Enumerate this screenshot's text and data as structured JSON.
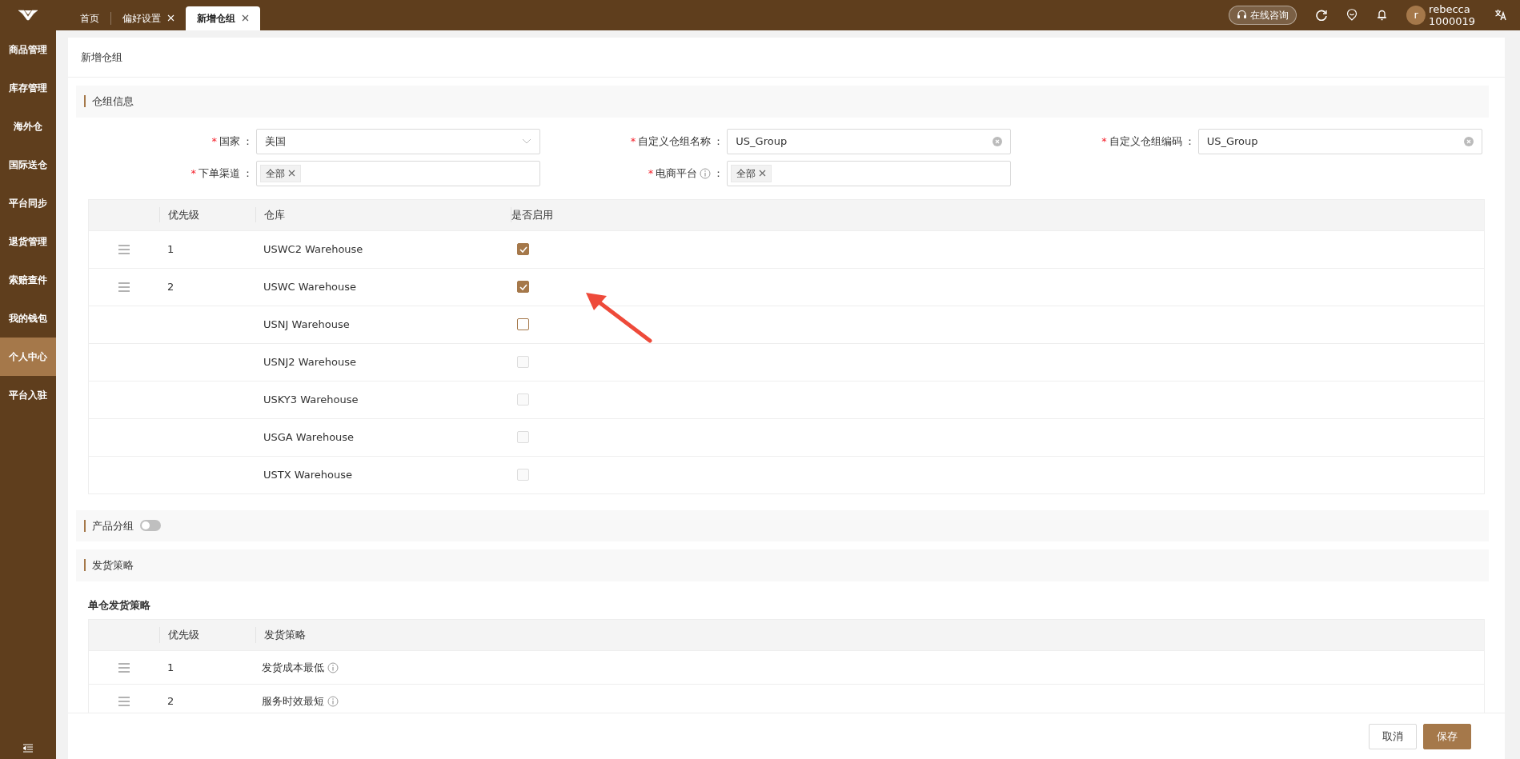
{
  "tabs": [
    {
      "label": "首页",
      "selected": false,
      "closable": false
    },
    {
      "label": "偏好设置",
      "selected": false,
      "closable": true
    },
    {
      "label": "新增仓组",
      "selected": true,
      "closable": true
    }
  ],
  "header": {
    "consult_button": "在线咨询",
    "user": {
      "avatar_letter": "r",
      "name": "rebecca",
      "id": "1000019"
    }
  },
  "sidebar": {
    "items": [
      {
        "label": "商品管理",
        "selected": false
      },
      {
        "label": "库存管理",
        "selected": false
      },
      {
        "label": "海外仓",
        "selected": false
      },
      {
        "label": "国际送仓",
        "selected": false
      },
      {
        "label": "平台同步",
        "selected": false
      },
      {
        "label": "退货管理",
        "selected": false
      },
      {
        "label": "索赔查件",
        "selected": false
      },
      {
        "label": "我的钱包",
        "selected": false
      },
      {
        "label": "个人中心",
        "selected": true
      },
      {
        "label": "平台入驻",
        "selected": false
      }
    ]
  },
  "page_title": "新增仓组",
  "group_info": {
    "title": "仓组信息",
    "fields": [
      {
        "required_mark": "*",
        "label": "国家",
        "info": false,
        "colon": "：",
        "kind": "select",
        "value": "美国"
      },
      {
        "required_mark": "*",
        "label": "自定义仓组名称",
        "info": false,
        "colon": "：",
        "kind": "text",
        "value": "US_Group"
      },
      {
        "required_mark": "*",
        "label": "自定义仓组编码",
        "info": false,
        "colon": "：",
        "kind": "text",
        "value": "US_Group"
      },
      {
        "required_mark": "*",
        "label": "下单渠道",
        "info": false,
        "colon": "：",
        "kind": "tags",
        "tags": [
          "全部"
        ]
      },
      {
        "required_mark": "*",
        "label": "电商平台",
        "info": true,
        "colon": "：",
        "kind": "tags",
        "tags": [
          "全部"
        ]
      }
    ],
    "table": {
      "columns": [
        "优先级",
        "仓库",
        "是否启用"
      ],
      "rows": [
        {
          "draggable": true,
          "priority": "1",
          "warehouse": "USWC2 Warehouse",
          "checked": true,
          "disabled": false
        },
        {
          "draggable": true,
          "priority": "2",
          "warehouse": "USWC Warehouse",
          "checked": true,
          "disabled": false
        },
        {
          "draggable": false,
          "warehouse": "USNJ Warehouse",
          "checked": false,
          "disabled": false
        },
        {
          "draggable": false,
          "warehouse": "USNJ2 Warehouse",
          "checked": false,
          "disabled": true
        },
        {
          "draggable": false,
          "warehouse": "USKY3 Warehouse",
          "checked": false,
          "disabled": true
        },
        {
          "draggable": false,
          "warehouse": "USGA Warehouse",
          "checked": false,
          "disabled": true
        },
        {
          "draggable": false,
          "warehouse": "USTX Warehouse",
          "checked": false,
          "disabled": true
        }
      ]
    }
  },
  "product_group": {
    "title": "产品分组",
    "on": false
  },
  "shipping": {
    "title": "发货策略",
    "subtitle": "单仓发货策略",
    "table": {
      "columns": [
        "优先级",
        "发货策略"
      ],
      "rows": [
        {
          "draggable": true,
          "priority": "1",
          "strategy": "发货成本最低",
          "info": true
        },
        {
          "draggable": true,
          "priority": "2",
          "strategy": "服务时效最短",
          "info": true
        }
      ]
    }
  },
  "footer": {
    "buttons": [
      {
        "label": "取消",
        "kind": "secondary"
      },
      {
        "label": "保存",
        "kind": "primary"
      }
    ]
  }
}
